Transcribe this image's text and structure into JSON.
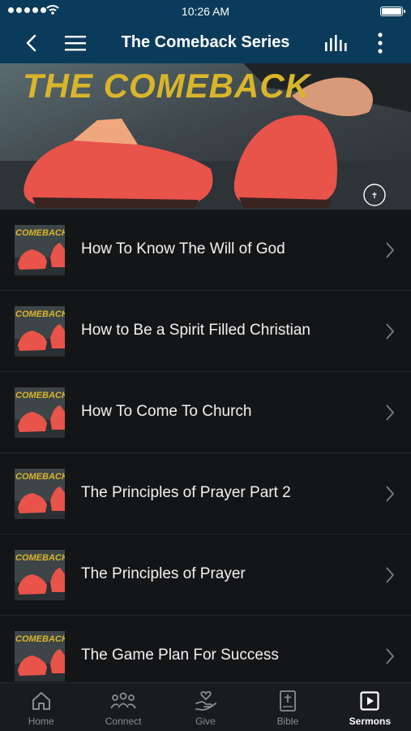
{
  "status_bar": {
    "time": "10:26 AM"
  },
  "nav": {
    "title": "The Comeback Series"
  },
  "hero": {
    "text": "THE COMEBACK"
  },
  "thumbnail_text": "COMEBACK",
  "sermons": [
    {
      "title": "How To Know The Will of God"
    },
    {
      "title": "How to Be a Spirit Filled Christian"
    },
    {
      "title": "How To Come To Church"
    },
    {
      "title": "The Principles of Prayer Part 2"
    },
    {
      "title": "The Principles of Prayer"
    },
    {
      "title": "The Game Plan For Success"
    }
  ],
  "tabs": [
    {
      "label": "Home",
      "icon": "home-icon"
    },
    {
      "label": "Connect",
      "icon": "people-icon"
    },
    {
      "label": "Give",
      "icon": "heart-hand-icon"
    },
    {
      "label": "Bible",
      "icon": "bible-icon"
    },
    {
      "label": "Sermons",
      "icon": "play-square-icon",
      "active": true
    }
  ],
  "colors": {
    "nav_bg": "#0b3b5a",
    "list_bg": "#141517",
    "tab_bg": "#1a1b1e",
    "hero_text": "#d9b52a",
    "shoe": "#e8534a"
  }
}
